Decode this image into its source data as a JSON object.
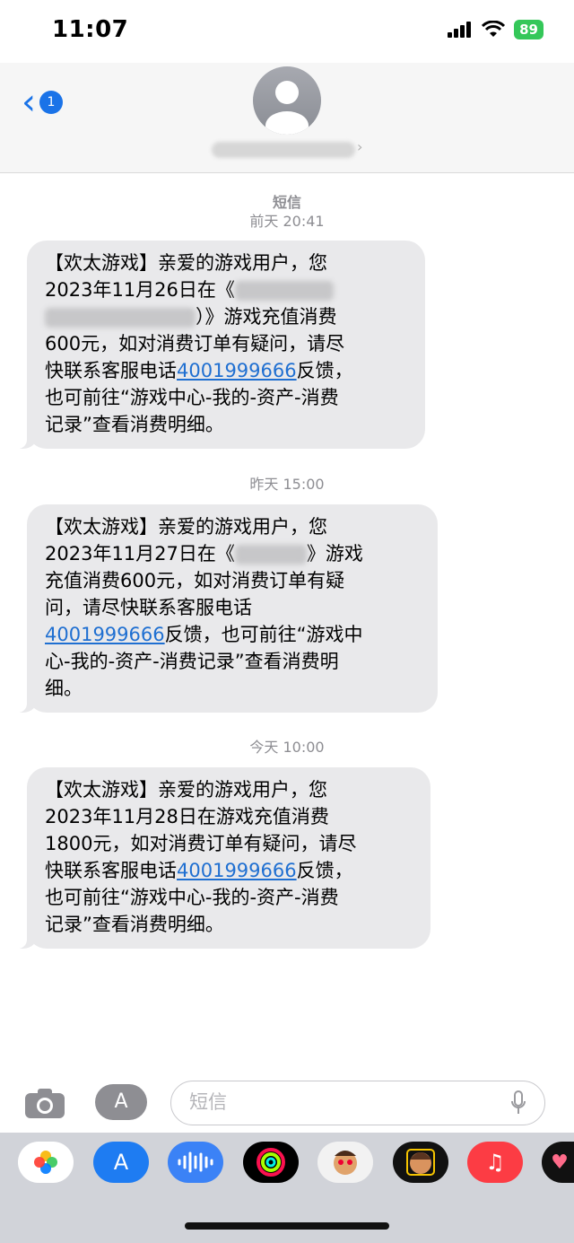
{
  "status": {
    "time": "11:07",
    "battery": "89"
  },
  "header": {
    "back_badge": "1"
  },
  "messages": [
    {
      "service": "短信",
      "timestamp": "前天 20:41",
      "lines": [
        "【欢太游戏】亲爱的游戏用户，您",
        "2023年11月26日在《",
        "）》游戏充值消费",
        "600元，如对消费订单有疑问，请尽",
        "快联系客服电话",
        "反馈，",
        "也可前往“游戏中心-我的-资产-消费",
        "记录”查看消费明细。"
      ],
      "phone": "4001999666"
    },
    {
      "timestamp": "昨天 15:00",
      "lines": [
        "【欢太游戏】亲爱的游戏用户，您",
        "2023年11月27日在《",
        "》游戏",
        "充值消费600元，如对消费订单有疑",
        "问，请尽快联系客服电话",
        "反馈，也可前往“游戏中",
        "心-我的-资产-消费记录”查看消费明",
        "细。"
      ],
      "phone": "4001999666"
    },
    {
      "timestamp": "今天 10:00",
      "lines": [
        "【欢太游戏】亲爱的游戏用户，您",
        "2023年11月28日在游戏充值消费",
        "1800元，如对消费订单有疑问，请尽",
        "快联系客服电话",
        "反馈，",
        "也可前往“游戏中心-我的-资产-消费",
        "记录”查看消费明细。"
      ],
      "phone": "4001999666"
    }
  ],
  "input": {
    "placeholder": "短信"
  },
  "icons": [
    "camera-icon",
    "app-store-icon",
    "mic-icon",
    "photos-app-icon",
    "app-store-app-icon",
    "audio-app-icon",
    "activity-app-icon",
    "memoji-app-icon",
    "animoji-app-icon",
    "music-app-icon",
    "heart-app-icon"
  ],
  "colors": {
    "accent": "#1a73e8",
    "bubble": "#e9e9eb",
    "link": "#1f6fd1",
    "battery": "#34c759"
  }
}
